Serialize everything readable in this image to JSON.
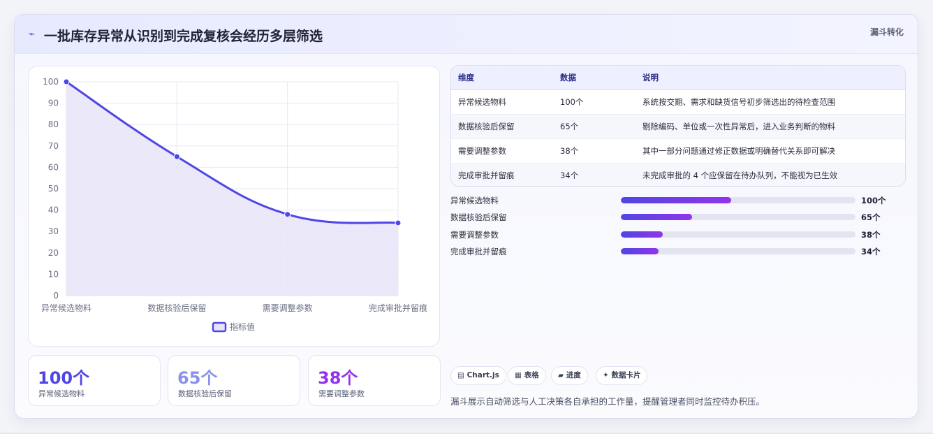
{
  "header": {
    "icon": "⌁",
    "title": "一批库存异常从识别到完成复核会经历多层筛选",
    "tag": "漏斗转化"
  },
  "chart_data": {
    "type": "line",
    "categories": [
      "异常候选物料",
      "数据核验后保留",
      "需要调整参数",
      "完成审批并留痕"
    ],
    "series": [
      {
        "name": "指标值",
        "values": [
          100,
          65,
          38,
          34
        ]
      }
    ],
    "ylim": [
      0,
      100
    ],
    "yticks": [
      "0",
      "10",
      "20",
      "30",
      "40",
      "50",
      "60",
      "70",
      "80",
      "90",
      "100"
    ],
    "area_fill": true,
    "legend": "bottom",
    "colors": {
      "line": "#4f46e5",
      "fill": "#e6e4f8"
    }
  },
  "kpis": [
    {
      "value": "100个",
      "label": "异常候选物料",
      "color": "#4f46e5"
    },
    {
      "value": "65个",
      "label": "数据核验后保留",
      "color": "#8a93ec"
    },
    {
      "value": "38个",
      "label": "需要调整参数",
      "color": "#9333ea"
    }
  ],
  "table": {
    "headers": [
      "维度",
      "数据",
      "说明"
    ],
    "rows": [
      [
        "异常候选物料",
        "100个",
        "系统按交期、需求和缺货信号初步筛选出的待检查范围"
      ],
      [
        "数据核验后保留",
        "65个",
        "剔除编码、单位或一次性异常后，进入业务判断的物料"
      ],
      [
        "需要调整参数",
        "38个",
        "其中一部分问题通过修正数据或明确替代关系即可解决"
      ],
      [
        "完成审批并留痕",
        "34个",
        "未完成审批的 4 个应保留在待办队列，不能视为已生效"
      ]
    ]
  },
  "progress": [
    {
      "label": "异常候选物料",
      "value": "100个",
      "fraction": 0.47
    },
    {
      "label": "数据核验后保留",
      "value": "65个",
      "fraction": 0.305
    },
    {
      "label": "需要调整参数",
      "value": "38个",
      "fraction": 0.178
    },
    {
      "label": "完成审批并留痕",
      "value": "34个",
      "fraction": 0.16
    }
  ],
  "chips": [
    {
      "icon": "▤",
      "label": "Chart.js"
    },
    {
      "icon": "▦",
      "label": "表格"
    },
    {
      "icon": "▰",
      "label": "进度"
    },
    {
      "icon": "✦",
      "label": "数据卡片"
    }
  ],
  "footnote": "漏斗展示自动筛选与人工决策各自承担的工作量，提醒管理者同时监控待办积压。"
}
